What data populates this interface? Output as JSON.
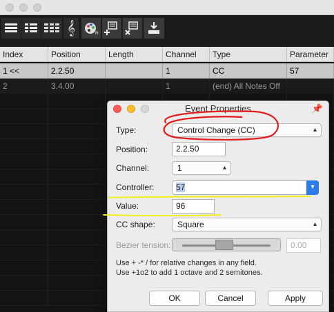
{
  "toolbar": {
    "icons": [
      "list-view-icon",
      "list-detail-icon",
      "grid-view-icon",
      "treble-clef-icon",
      "palette-icon",
      "add-event-icon",
      "delete-event-icon",
      "import-icon"
    ]
  },
  "table": {
    "columns": [
      "Index",
      "Position",
      "Length",
      "Channel",
      "Type",
      "Parameter"
    ],
    "rows": [
      {
        "index": "1 <<",
        "position": "2.2.50",
        "length": "",
        "channel": "1",
        "type": "CC",
        "parameter": "57"
      },
      {
        "index": "2",
        "position": "3.4.00",
        "length": "",
        "channel": "1",
        "type": "(end) All Notes Off",
        "parameter": ""
      }
    ]
  },
  "dialog": {
    "title": "Event Properties",
    "type_label": "Type:",
    "type_value": "Control Change (CC)",
    "position_label": "Position:",
    "position_value": "2.2.50",
    "channel_label": "Channel:",
    "channel_value": "1",
    "controller_label": "Controller:",
    "controller_value": "57",
    "value_label": "Value:",
    "value_value": "96",
    "cc_shape_label": "CC shape:",
    "cc_shape_value": "Square",
    "bezier_label": "Bezier tension:",
    "bezier_value": "0.00",
    "hint1": "Use + -* / for relative changes in any field.",
    "hint2": "Use +1o2  to add 1 octave and 2 semitones.",
    "ok_label": "OK",
    "cancel_label": "Cancel",
    "apply_label": "Apply"
  },
  "colors": {
    "annotation_red": "#e21b1b",
    "annotation_yellow": "#f2ee1b",
    "accent_blue": "#2d7be6",
    "selection_highlight": "#b8cff0"
  }
}
